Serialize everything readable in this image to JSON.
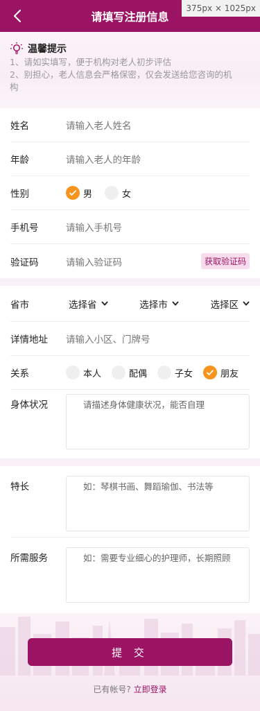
{
  "colors": {
    "brand": "#9b1464",
    "accent": "#f7941d",
    "muted": "#999999"
  },
  "header": {
    "title": "请填写注册信息",
    "size_badge": "375px × 1025px",
    "back_icon": "chevron-left-icon"
  },
  "notice": {
    "title": "温馨提示",
    "icon": "lightbulb-icon",
    "lines": [
      "1、请如实填写，便于机构对老人初步评估",
      "2、别担心，老人信息会严格保密，仅会发送给您咨询的机",
      "构"
    ]
  },
  "form": {
    "name": {
      "label": "姓名",
      "placeholder": "请输入老人姓名"
    },
    "age": {
      "label": "年龄",
      "placeholder": "请输入老人的年龄"
    },
    "gender": {
      "label": "性别",
      "options": [
        "男",
        "女"
      ],
      "selected": "男"
    },
    "phone": {
      "label": "手机号",
      "placeholder": "请输入手机号"
    },
    "code": {
      "label": "验证码",
      "placeholder": "请输入验证码",
      "button": "获取验证码"
    },
    "region": {
      "label": "省市",
      "province": "选择省",
      "city": "选择市",
      "district": "选择区"
    },
    "address": {
      "label": "详情地址",
      "placeholder": "请输入小区、门牌号"
    },
    "relation": {
      "label": "关系",
      "options": [
        "本人",
        "配偶",
        "子女",
        "朋友"
      ],
      "selected": "朋友"
    },
    "health": {
      "label": "身体状况",
      "placeholder": "请描述身体健康状况，能否自理"
    },
    "skills": {
      "label": "特长",
      "placeholder": "如：琴棋书画、舞蹈瑜伽、书法等"
    },
    "service": {
      "label": "所需服务",
      "placeholder": "如：需要专业细心的护理师，长期照顾"
    }
  },
  "footer": {
    "submit": "提 交",
    "login_prompt": "已有帐号?",
    "login_link": "立即登录"
  }
}
